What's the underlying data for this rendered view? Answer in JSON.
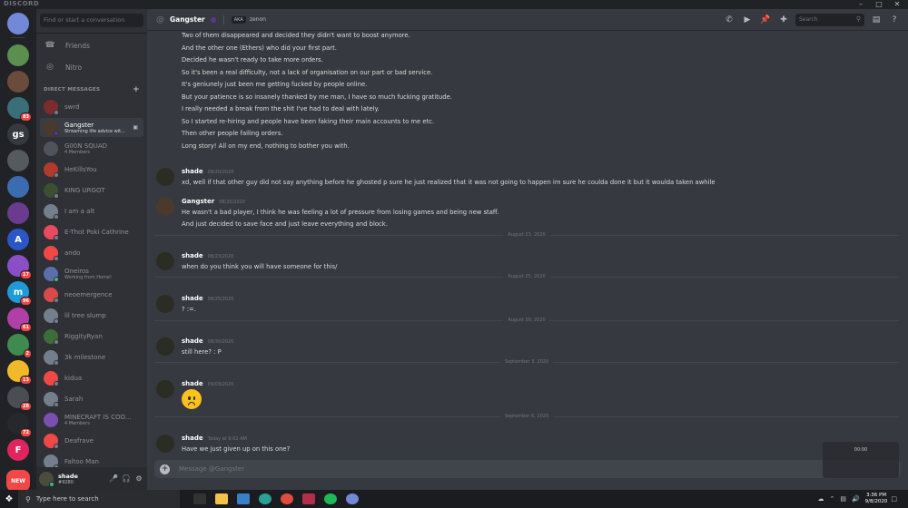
{
  "window": {
    "brand": "DISCORD",
    "minimize": "–",
    "maximize": "□",
    "close": "✕"
  },
  "guilds": [
    {
      "label": "",
      "color": "#7289da",
      "icon": "discord-home-icon",
      "badge": ""
    },
    {
      "label": "",
      "color": "#5a8f4f",
      "badge": ""
    },
    {
      "label": "",
      "color": "#6b4b3b",
      "badge": ""
    },
    {
      "label": "",
      "color": "#3a6f7a",
      "badge": "83"
    },
    {
      "label": "gs",
      "color": "#36393f",
      "badge": ""
    },
    {
      "label": "",
      "color": "#555a5f",
      "badge": ""
    },
    {
      "label": "",
      "color": "#3b6cb0",
      "badge": ""
    },
    {
      "label": "",
      "color": "#6a3b8f",
      "badge": ""
    },
    {
      "label": "A",
      "color": "#2b56c8",
      "badge": ""
    },
    {
      "label": "",
      "color": "#8a4fc8",
      "badge": "17"
    },
    {
      "label": "m",
      "color": "#1e9ad6",
      "badge": "96"
    },
    {
      "label": "",
      "color": "#b03fa8",
      "badge": "61"
    },
    {
      "label": "",
      "color": "#3e8a4f",
      "badge": "2"
    },
    {
      "label": "",
      "color": "#f0b929",
      "badge": "13"
    },
    {
      "label": "",
      "color": "#4a4d52",
      "badge": "28"
    },
    {
      "label": "",
      "color": "#26282b",
      "badge": "72"
    },
    {
      "label": "F",
      "color": "#e0245e",
      "badge": ""
    }
  ],
  "new_button": "NEW",
  "dm_sidebar": {
    "search_placeholder": "Find or start a conversation",
    "friends": "Friends",
    "nitro": "Nitro",
    "header": "DIRECT MESSAGES",
    "add": "+",
    "items": [
      {
        "name": "swrd",
        "sub": "",
        "color": "#7b2d2d",
        "status": "offline",
        "active": false
      },
      {
        "name": "Gangster",
        "sub": "Streaming life advice wit...",
        "color": "#4b3a2b",
        "status": "streaming",
        "active": true
      },
      {
        "name": "G00N SQUAD",
        "sub": "4 Members",
        "color": "#4f545c",
        "status": "",
        "active": false
      },
      {
        "name": "HeKillsYou",
        "sub": "",
        "color": "#b03a2e",
        "status": "offline",
        "active": false
      },
      {
        "name": "KING URGOT",
        "sub": "",
        "color": "#3c4f32",
        "status": "offline",
        "active": false
      },
      {
        "name": "I am a alt",
        "sub": "",
        "color": "#747f8d",
        "status": "offline",
        "active": false
      },
      {
        "name": "E-Thot Poki Cathrine",
        "sub": "",
        "color": "#e84a5f",
        "status": "offline",
        "active": false
      },
      {
        "name": "ando",
        "sub": "",
        "color": "#f04747",
        "status": "offline",
        "active": false
      },
      {
        "name": "Oneiros",
        "sub": "Working from Home!",
        "color": "#5b6fa8",
        "status": "online",
        "active": false
      },
      {
        "name": "neoemergence",
        "sub": "",
        "color": "#d94a4a",
        "status": "offline",
        "active": false
      },
      {
        "name": "lil tree slump",
        "sub": "",
        "color": "#747f8d",
        "status": "offline",
        "active": false
      },
      {
        "name": "RiggityRyan",
        "sub": "",
        "color": "#3c6e3a",
        "status": "offline",
        "active": false
      },
      {
        "name": "3k milestone",
        "sub": "",
        "color": "#747f8d",
        "status": "offline",
        "active": false
      },
      {
        "name": "kidua",
        "sub": "",
        "color": "#f04747",
        "status": "offline",
        "active": false
      },
      {
        "name": "Sarah",
        "sub": "",
        "color": "#747f8d",
        "status": "offline",
        "active": false
      },
      {
        "name": "MINECRAFT IS COO...",
        "sub": "4 Members",
        "color": "#7a4fb0",
        "status": "",
        "active": false
      },
      {
        "name": "Deafrave",
        "sub": "",
        "color": "#f04747",
        "status": "offline",
        "active": false
      },
      {
        "name": "Faltoo Man",
        "sub": "",
        "color": "#747f8d",
        "status": "offline",
        "active": false
      }
    ]
  },
  "user_panel": {
    "name": "shade",
    "tag": "#9280"
  },
  "topbar": {
    "at": "@",
    "name": "Gangster",
    "aka": "AKA",
    "nickname": "zenon",
    "search_placeholder": "Search"
  },
  "messages": {
    "continued_lines": [
      "Two of them disappeared and decided they didn't want to boost anymore.",
      "And the other one (Ethers) who did your first part.",
      "Decided he wasn't ready to take more orders.",
      "So it's been a real difficulty, not a lack of organisation on our part or bad service.",
      "It's geniunely just been me getting fucked by people online.",
      "But your patience is so insanely thanked by me man, I have so much fucking gratitude.",
      "I really needed a break from the shit I've had to deal with lately.",
      "So I started re-hiring and people have been faking their main accounts to me etc.",
      "Then other people failing orders.",
      "Long story! All on my end, nothing to bother you with."
    ],
    "groups": [
      {
        "author": "shade",
        "time": "08/20/2020",
        "lines": [
          "xd, well if that other guy did not say anything before he ghosted p sure he just realized that it was not going to happen im sure he coulda done it but it woulda taken awhile"
        ]
      },
      {
        "author": "Gangster",
        "time": "08/20/2020",
        "lines": [
          "He wasn't a bad player, I think he was feeling a lot of pressure from losing games and being new staff.",
          "And just decided to save face and just leave everything and block."
        ]
      },
      {
        "author": "shade",
        "time": "08/23/2020",
        "lines": [
          "when do you think you will have someone for this/"
        ]
      },
      {
        "author": "shade",
        "time": "08/25/2020",
        "lines": [
          "? :=."
        ]
      },
      {
        "author": "shade",
        "time": "08/30/2020",
        "lines": [
          "still here? : P"
        ]
      },
      {
        "author": "shade",
        "time": "09/03/2020",
        "lines": []
      },
      {
        "author": "shade",
        "time": "Today at 9:02 AM",
        "lines": [
          "Have we just given up on this one?"
        ]
      }
    ],
    "dividers": [
      "August 23, 2020",
      "August 25, 2020",
      "August 30, 2020",
      "September 3, 2020",
      "September 6, 2020"
    ]
  },
  "composer": {
    "placeholder": "Message @Gangster"
  },
  "recording": {
    "time": "00:00"
  },
  "taskbar": {
    "search_placeholder": "Type here to search",
    "time": "3:36 PM",
    "date": "9/8/2020"
  }
}
